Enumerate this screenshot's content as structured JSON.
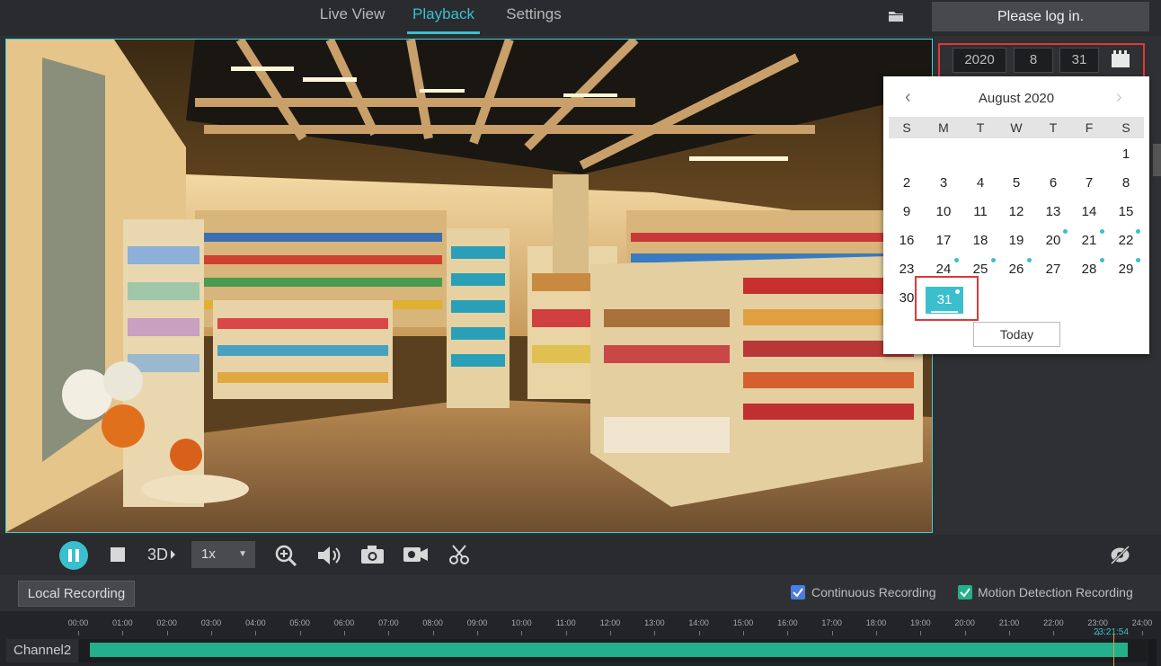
{
  "nav": {
    "tabs": [
      {
        "label": "Live View"
      },
      {
        "label": "Playback"
      },
      {
        "label": "Settings"
      }
    ],
    "active": "Playback"
  },
  "login_label": "Please log in.",
  "date": {
    "year": "2020",
    "month": "8",
    "day": "31"
  },
  "calendar": {
    "title": "August 2020",
    "prev": "‹",
    "next": "›",
    "weekdays": [
      "S",
      "M",
      "T",
      "W",
      "T",
      "F",
      "S"
    ],
    "days": [
      "1",
      "2",
      "3",
      "4",
      "5",
      "6",
      "7",
      "8",
      "9",
      "10",
      "11",
      "12",
      "13",
      "14",
      "15",
      "16",
      "17",
      "18",
      "19",
      "20",
      "21",
      "22",
      "23",
      "24",
      "25",
      "26",
      "27",
      "28",
      "29",
      "30",
      "31"
    ],
    "selected": "31",
    "today_label": "Today"
  },
  "controls": {
    "speed": "1x",
    "speed_caret": "▼"
  },
  "recording": {
    "local_label": "Local Recording",
    "continuous_label": "Continuous Recording",
    "motion_label": "Motion Detection Recording",
    "continuous_color": "#4a7de0",
    "motion_color": "#23b08b"
  },
  "timeline": {
    "hours": [
      "00:00",
      "01:00",
      "02:00",
      "03:00",
      "04:00",
      "05:00",
      "06:00",
      "07:00",
      "08:00",
      "09:00",
      "10:00",
      "11:00",
      "12:00",
      "13:00",
      "14:00",
      "15:00",
      "16:00",
      "17:00",
      "18:00",
      "19:00",
      "20:00",
      "21:00",
      "22:00",
      "23:00",
      "24:00"
    ],
    "channel": "Channel2",
    "cursor_time": "23:21:54"
  },
  "colors": {
    "accent": "#3bbfcf",
    "highlight": "#e0383a"
  }
}
